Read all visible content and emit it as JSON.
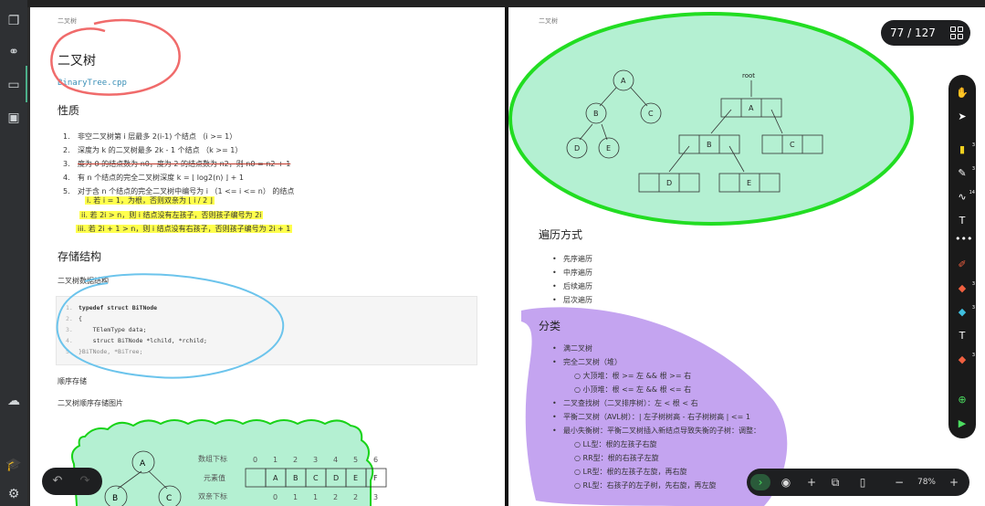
{
  "left_page": {
    "running_head": "二叉树",
    "title": "二叉树",
    "file_link": "BinaryTree.cpp",
    "properties_heading": "性质",
    "properties": [
      {
        "num": "1.",
        "text": "非空二叉树第 i 层最多 2(i-1) 个结点 （i >= 1）"
      },
      {
        "num": "2.",
        "text": "深度为 k 的二叉树最多 2k - 1 个结点 （k >= 1）"
      },
      {
        "num": "3.",
        "text": "度为 0 的结点数为 n0，度为 2 的结点数为 n2，则 n0 = n2 + 1"
      },
      {
        "num": "4.",
        "text": "有 n 个结点的完全二叉树深度 k = ⌊ log2(n) ⌋ + 1"
      },
      {
        "num": "5.",
        "text": "对于含 n 个结点的完全二叉树中编号为 i （1 <= i <= n） 的结点"
      }
    ],
    "sub_properties": [
      "i.  若 i = 1，为根，否则双亲为 ⌊ i / 2 ⌋",
      "ii.  若 2i > n，则 i 结点没有左孩子，否则孩子编号为 2i",
      "iii.  若 2i + 1 > n，则 i 结点没有右孩子，否则孩子编号为 2i + 1"
    ],
    "storage_heading": "存储结构",
    "storage_sub": "二叉树数据结构",
    "code_lines": [
      {
        "ln": "1.",
        "text": "typedef struct BiTNode"
      },
      {
        "ln": "2.",
        "text": "{"
      },
      {
        "ln": "3.",
        "text": "    TElemType data;"
      },
      {
        "ln": "4.",
        "text": "    struct BiTNode *lchild, *rchild;"
      },
      {
        "ln": "5.",
        "text": "}BiTNode, *BiTree;"
      }
    ],
    "seq_storage": "顺序存储",
    "seq_image_caption": "二叉树顺序存储图片",
    "array_diagram": {
      "index_label": "数组下标",
      "indices": [
        "0",
        "1",
        "2",
        "3",
        "4",
        "5",
        "6"
      ],
      "value_label": "元素值",
      "values": [
        "",
        "A",
        "B",
        "C",
        "D",
        "E",
        "F"
      ],
      "parent_label": "双亲下标",
      "parents": [
        "0",
        "1",
        "1",
        "2",
        "2",
        "3"
      ],
      "tree_nodes": [
        "A",
        "B",
        "C"
      ]
    }
  },
  "right_page": {
    "running_head": "二叉树",
    "tree_diagram": {
      "nodes": [
        "A",
        "B",
        "C",
        "D",
        "E"
      ]
    },
    "linked_diagram": {
      "root_label": "root",
      "nodes": [
        "A",
        "B",
        "C",
        "D",
        "E"
      ]
    },
    "traversal_heading": "遍历方式",
    "traversals": [
      "先序遍历",
      "中序遍历",
      "后续遍历",
      "层次遍历"
    ],
    "category_heading": "分类",
    "categories": [
      "满二叉树",
      "完全二叉树（堆）",
      "二叉查找树（二叉排序树）：左 < 根 < 右",
      "平衡二叉树（AVL树）：| 左子树树高 - 右子树树高 | <= 1",
      "最小失衡树：平衡二叉树插入新结点导致失衡的子树：调整："
    ],
    "heap_sub": [
      "大顶堆：根 >= 左 && 根 >= 右",
      "小顶堆：根 <= 左 && 根 <= 右"
    ],
    "rotation_sub": [
      "LL型：根的左孩子右旋",
      "RR型：根的右孩子左旋",
      "LR型：根的左孩子左旋，再右旋",
      "RL型：右孩子的左子树，先右旋，再左旋"
    ]
  },
  "page_indicator": "77 / 127",
  "zoom_level": "78%",
  "colors": {
    "highlight": "#ffff4d",
    "annotation_red": "#f06b6b",
    "annotation_blue": "#6cc4ec",
    "annotation_green": "#22dd22",
    "annotation_purple": "#c4a4f0",
    "diagram_fill": "#b4f0d2",
    "cloud_border": "#19d319"
  },
  "icons": {
    "sidebar": [
      "pages-icon",
      "binoculars-icon",
      "card-icon",
      "save-icon",
      "cloud-icon",
      "graduation-icon",
      "gear-icon"
    ],
    "tools": [
      "hand-icon",
      "pointer-icon",
      "highlighter-icon",
      "pencil-icon",
      "wave-pen-icon",
      "text-tool-icon",
      "more-icon",
      "marker-icon",
      "eraser-icon",
      "shape-icon",
      "text-icon",
      "brush-icon",
      "add-icon",
      "record-icon"
    ]
  }
}
